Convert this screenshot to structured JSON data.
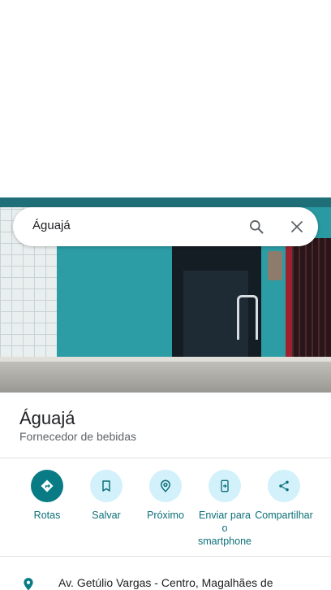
{
  "search": {
    "query": "Águajá"
  },
  "place": {
    "name": "Águajá",
    "category": "Fornecedor de bebidas"
  },
  "actions": [
    {
      "label": "Rotas",
      "icon": "directions-icon"
    },
    {
      "label": "Salvar",
      "icon": "bookmark-icon"
    },
    {
      "label": "Próximo",
      "icon": "nearby-icon"
    },
    {
      "label": "Enviar para o smartphone",
      "icon": "send-to-phone-icon"
    },
    {
      "label": "Compartilhar",
      "icon": "share-icon"
    }
  ],
  "address": {
    "text": "Av. Getúlio Vargas - Centro, Magalhães de"
  },
  "colors": {
    "accent": "#087b85",
    "accent_light": "#d2f1fb",
    "action_text": "#0b6f78"
  }
}
